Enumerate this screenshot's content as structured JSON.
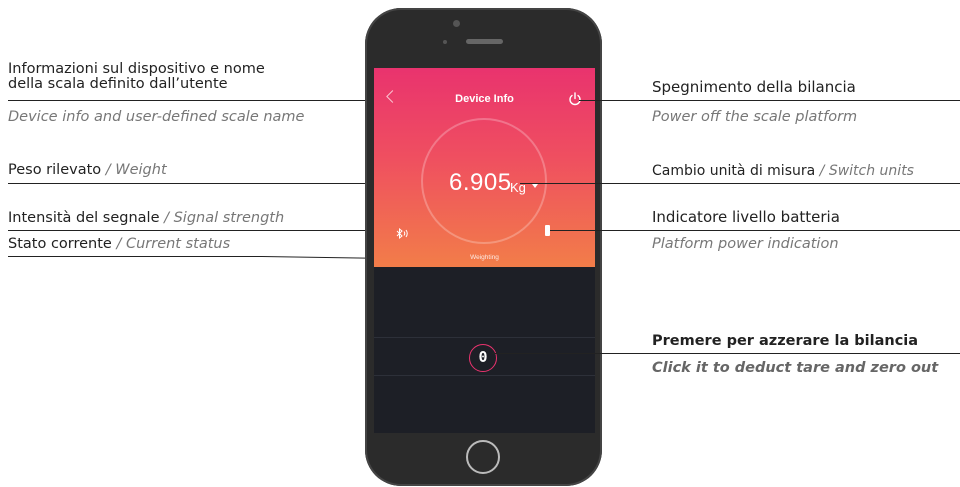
{
  "annotations": {
    "device_info": {
      "it_line1": "Informazioni sul dispositivo e nome",
      "it_line2": "della scala definito dall’utente",
      "en": "Device info and user-defined scale name"
    },
    "weight": {
      "it": "Peso rilevato",
      "en": "/ Weight"
    },
    "signal": {
      "it": "Intensità del segnale",
      "en": "/ Signal strength"
    },
    "status": {
      "it": "Stato corrente",
      "en": "/ Current status"
    },
    "power": {
      "it": "Spegnimento della bilancia",
      "en": "Power off the scale platform"
    },
    "units": {
      "it": "Cambio unità di misura",
      "en": "/ Switch units"
    },
    "battery": {
      "it": "Indicatore livello batteria",
      "en": "Platform power indication"
    },
    "tare": {
      "it": "Premere per azzerare la bilancia",
      "en": "Click it to deduct tare and zero out"
    }
  },
  "app": {
    "title": "Device Info",
    "weight": "6.905",
    "unit": "Kg",
    "status": "Weighting",
    "zero_label": "0",
    "icons": {
      "back": "chevron-left-icon",
      "power": "power-icon",
      "bluetooth": "bluetooth-signal-icon",
      "battery": "battery-icon"
    }
  },
  "colors": {
    "gradient_top": "#e9336e",
    "gradient_bottom": "#f27d49",
    "screen_bg": "#1d1f26",
    "phone_body": "#2b2b2b"
  }
}
